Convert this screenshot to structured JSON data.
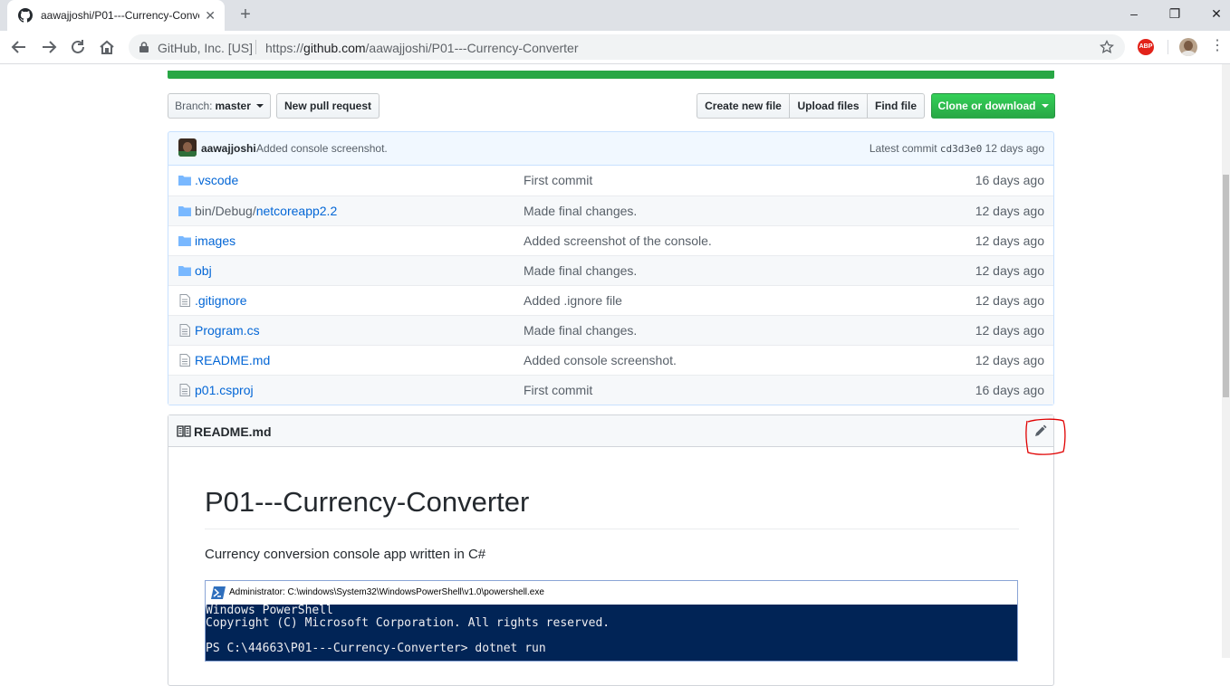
{
  "browser": {
    "tab_title": "aawajjoshi/P01---Currency-Converter",
    "site_identity": "GitHub, Inc. [US]",
    "url_prefix": "https://",
    "url_host": "github.com",
    "url_path": "/aawajjoshi/P01---Currency-Converter",
    "abp_label": "ABP"
  },
  "toolbar": {
    "branch_prefix": "Branch:",
    "branch_name": "master",
    "new_pr": "New pull request",
    "create_file": "Create new file",
    "upload_files": "Upload files",
    "find_file": "Find file",
    "clone": "Clone or download"
  },
  "commit": {
    "author": "aawajjoshi",
    "message": "Added console screenshot.",
    "latest_label": "Latest commit",
    "sha": "cd3d3e0",
    "age": "12 days ago"
  },
  "files": [
    {
      "type": "folder",
      "prefix": "",
      "name": ".vscode",
      "message": "First commit",
      "age": "16 days ago"
    },
    {
      "type": "folder",
      "prefix": "bin/Debug/",
      "name": "netcoreapp2.2",
      "message": "Made final changes.",
      "age": "12 days ago"
    },
    {
      "type": "folder",
      "prefix": "",
      "name": "images",
      "message": "Added screenshot of the console.",
      "age": "12 days ago"
    },
    {
      "type": "folder",
      "prefix": "",
      "name": "obj",
      "message": "Made final changes.",
      "age": "12 days ago"
    },
    {
      "type": "file",
      "prefix": "",
      "name": ".gitignore",
      "message": "Added .ignore file",
      "age": "12 days ago"
    },
    {
      "type": "file",
      "prefix": "",
      "name": "Program.cs",
      "message": "Made final changes.",
      "age": "12 days ago"
    },
    {
      "type": "file",
      "prefix": "",
      "name": "README.md",
      "message": "Added console screenshot.",
      "age": "12 days ago"
    },
    {
      "type": "file",
      "prefix": "",
      "name": "p01.csproj",
      "message": "First commit",
      "age": "16 days ago"
    }
  ],
  "readme": {
    "header": "README.md",
    "title": "P01---Currency-Converter",
    "description": "Currency conversion console app written in C#",
    "console_title": "Administrator: C:\\windows\\System32\\WindowsPowerShell\\v1.0\\powershell.exe",
    "console_lines": [
      "Windows PowerShell",
      "Copyright (C) Microsoft Corporation. All rights reserved.",
      "",
      "PS C:\\44663\\P01---Currency-Converter> dotnet run"
    ]
  },
  "colors": {
    "link": "#0366d6",
    "green": "#28a745",
    "powershell_bg": "#012456",
    "annotation": "#e00000"
  }
}
